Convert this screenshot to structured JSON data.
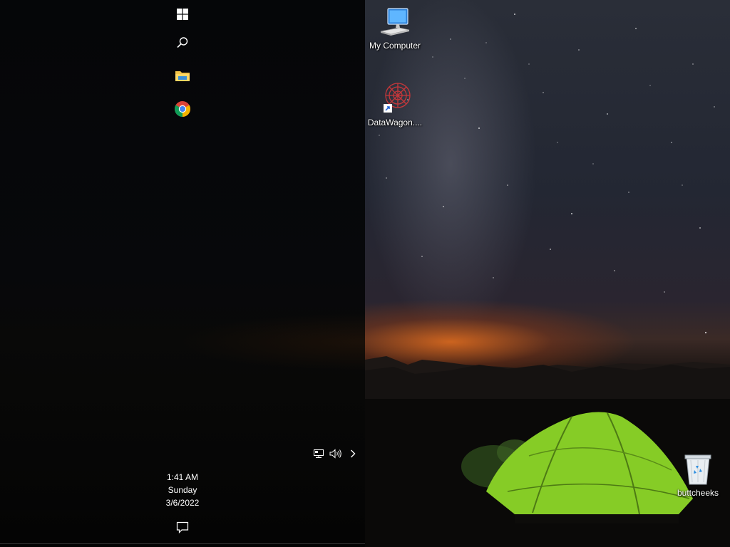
{
  "desktop": {
    "icons": [
      {
        "label": "My Computer",
        "icon": "computer-icon"
      },
      {
        "label": "DataWagon....",
        "icon": "datawagon-shortcut-icon"
      },
      {
        "label": "buttcheeks",
        "icon": "recycle-bin-icon"
      }
    ]
  },
  "taskbar": {
    "pinned": [
      {
        "name": "Start",
        "icon": "windows-logo-icon"
      },
      {
        "name": "Search",
        "icon": "search-icon"
      },
      {
        "name": "File Explorer",
        "icon": "folder-icon"
      },
      {
        "name": "Google Chrome",
        "icon": "chrome-icon"
      }
    ],
    "tray_icons": [
      "network-icon",
      "volume-icon",
      "chevron-right-icon"
    ],
    "clock": {
      "time": "1:41 AM",
      "day": "Sunday",
      "date": "3/6/2022"
    },
    "action_center_icon": "notification-icon"
  },
  "colors": {
    "taskbar_bg": "#050608",
    "tent_green": "#8fd42a",
    "sky_orange": "#e0702a"
  }
}
